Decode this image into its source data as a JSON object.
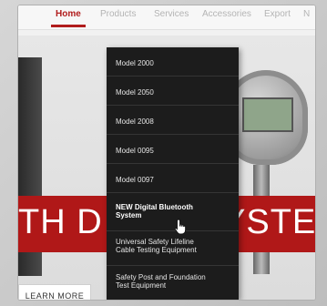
{
  "nav": {
    "items": [
      {
        "label": "Home",
        "active": true
      },
      {
        "label": "Products"
      },
      {
        "label": "Services"
      },
      {
        "label": "Accessories"
      },
      {
        "label": "Export"
      },
      {
        "label": "N"
      }
    ]
  },
  "dropdown": {
    "items": [
      {
        "label": "Model 2000"
      },
      {
        "label": "Model 2050"
      },
      {
        "label": "Model 2008"
      },
      {
        "label": "Model 0095"
      },
      {
        "label": "Model 0097"
      },
      {
        "label_lines": [
          "NEW Digital Bluetooth",
          "System"
        ],
        "highlighted": true
      },
      {
        "label_lines": [
          "Universal Safety Lifeline",
          "Cable Testing Equipment"
        ]
      },
      {
        "label_lines": [
          "Safety Post and Foundation",
          "Test Equipment"
        ]
      }
    ]
  },
  "hero": {
    "band_text_left": "TH D",
    "band_text_right": "YSTEM",
    "learn_more": "LEARN MORE"
  },
  "colors": {
    "accent": "#b11c1c",
    "dropdown_bg": "#1c1c1c"
  },
  "cursor_icon": "hand-pointer-icon"
}
